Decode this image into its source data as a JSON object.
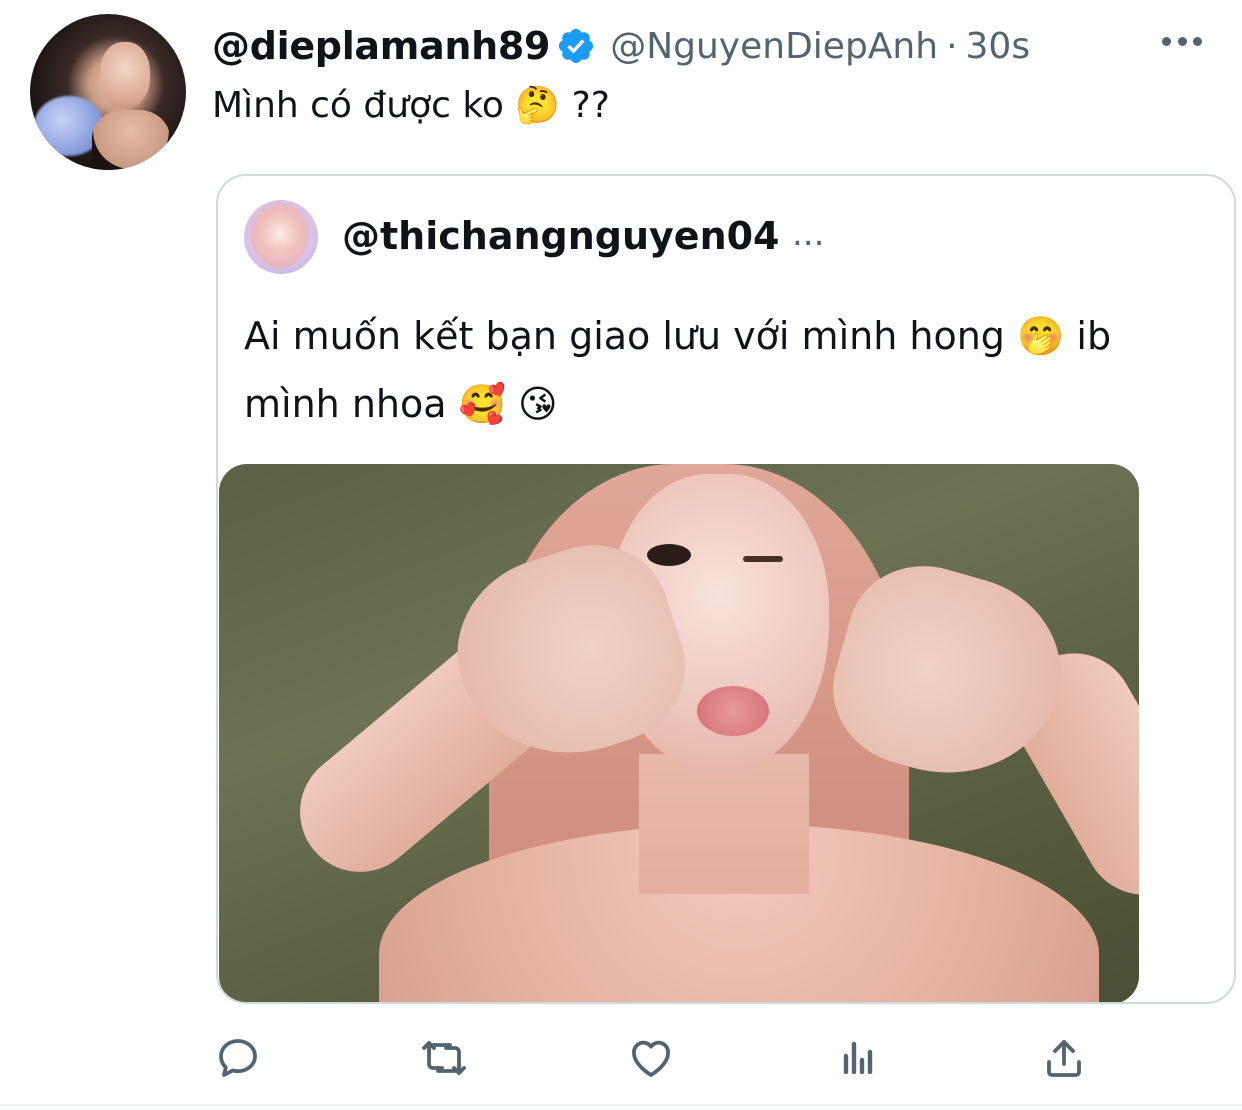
{
  "tweet": {
    "display_name": "@dieplamanh89",
    "handle": "@NguyenDiepAnh",
    "separator": "·",
    "time": "30s",
    "text": "Mình có được ko 🤔 ??"
  },
  "quoted_tweet": {
    "handle": "@thichangnguyen04",
    "ellipsis": "...",
    "text": "Ai muốn kết bạn giao lưu với mình hong 🤭  ib mình nhoa 🥰 😘"
  },
  "colors": {
    "text_primary": "#0f1419",
    "text_secondary": "#536471",
    "verified_blue": "#1d9bf0",
    "border": "#cfd9de"
  },
  "icons": {
    "verified": "verified-badge-icon",
    "more": "more-horizontal-icon",
    "reply": "reply-icon",
    "retweet": "retweet-icon",
    "like": "heart-icon",
    "views": "analytics-icon",
    "share": "share-icon"
  }
}
